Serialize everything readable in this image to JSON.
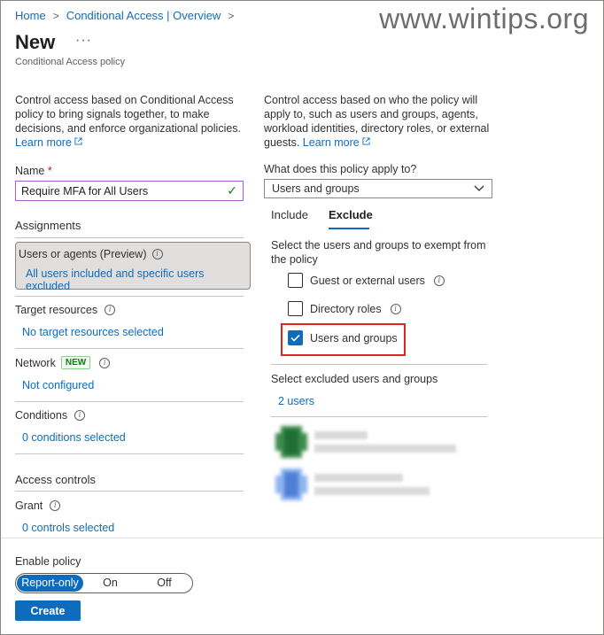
{
  "breadcrumb": {
    "home": "Home",
    "overview": "Conditional Access | Overview"
  },
  "watermark": "www.wintips.org",
  "header": {
    "title": "New",
    "more": "···",
    "subtitle": "Conditional Access policy"
  },
  "left": {
    "description": "Control access based on Conditional Access policy to bring signals together, to make decisions, and enforce organizational policies.",
    "learn_more": "Learn more",
    "name_label": "Name",
    "name_required": "*",
    "name_value": "Require MFA for All Users",
    "assignments_title": "Assignments",
    "users_agents": {
      "label": "Users or agents (Preview)",
      "value": "All users included and specific users excluded"
    },
    "target_resources": {
      "label": "Target resources",
      "value": "No target resources selected"
    },
    "network": {
      "label": "Network",
      "badge": "NEW",
      "value": "Not configured"
    },
    "conditions": {
      "label": "Conditions",
      "value": "0 conditions selected"
    },
    "access_controls_title": "Access controls",
    "grant": {
      "label": "Grant",
      "value": "0 controls selected"
    }
  },
  "right": {
    "description": "Control access based on who the policy will apply to, such as users and groups, agents, workload identities, directory roles, or external guests.",
    "learn_more": "Learn more",
    "apply_label": "What does this policy apply to?",
    "apply_value": "Users and groups",
    "tabs": [
      {
        "label": "Include",
        "active": false
      },
      {
        "label": "Exclude",
        "active": true
      }
    ],
    "exempt_text": "Select the users and groups to exempt from the policy",
    "options": [
      {
        "label": "Guest or external users",
        "checked": false,
        "has_info": true
      },
      {
        "label": "Directory roles",
        "checked": false,
        "has_info": true
      },
      {
        "label": "Users and groups",
        "checked": true,
        "has_info": false
      }
    ],
    "select_excluded_label": "Select excluded users and groups",
    "selected_count": "2 users"
  },
  "footer": {
    "enable_label": "Enable policy",
    "toggle": [
      {
        "label": "Report-only",
        "active": true
      },
      {
        "label": "On",
        "active": false
      },
      {
        "label": "Off",
        "active": false
      }
    ],
    "create_label": "Create"
  },
  "colors": {
    "accent": "#0f6cbd",
    "highlight": "#e02424",
    "badge_green": "#107c10"
  }
}
